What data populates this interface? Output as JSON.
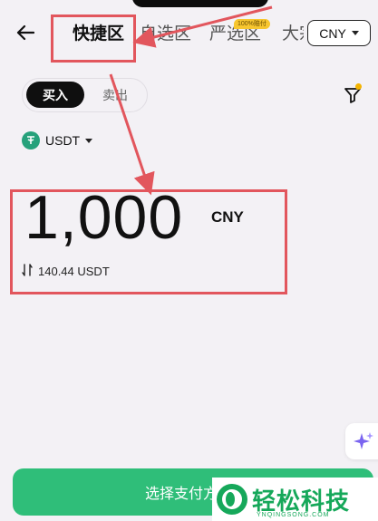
{
  "header": {
    "tabs": [
      {
        "label": "快捷区",
        "active": true
      },
      {
        "label": "自选区",
        "active": false
      },
      {
        "label": "严选区",
        "active": false
      },
      {
        "label": "大宗区",
        "active": false
      }
    ],
    "strict_badge": "100%赔付",
    "currency": "CNY"
  },
  "trade": {
    "buy_label": "买入",
    "sell_label": "卖出",
    "asset": "USDT",
    "amount": "1,000",
    "amount_currency": "CNY",
    "converted": "140.44 USDT"
  },
  "footer": {
    "pay_button": "选择支付方式"
  },
  "watermark": {
    "text": "轻松科技",
    "sub": "YNQINGSONG.COM"
  },
  "colors": {
    "accent_green": "#2fbe79",
    "annotation_red": "#e2565d",
    "badge_yellow": "#f7c62f"
  }
}
